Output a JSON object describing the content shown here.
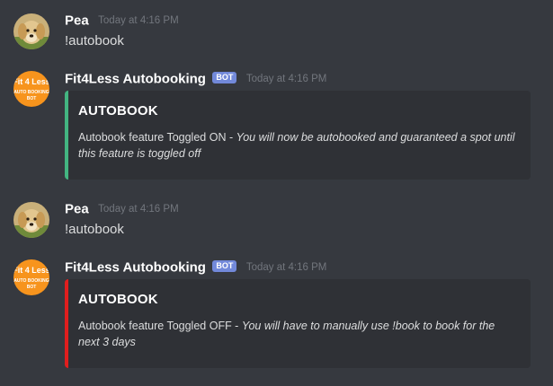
{
  "messages": [
    {
      "author": "Pea",
      "timestamp": "Today at 4:16 PM",
      "content": "!autobook",
      "avatar": "golden-retriever-dog-icon"
    },
    {
      "author": "Fit4Less Autobooking",
      "bot_tag": "BOT",
      "timestamp": "Today at 4:16 PM",
      "avatar": "fit4less-autobooking-logo-icon",
      "avatar_text": [
        "Fit 4 Less",
        "AUTO BOOKING",
        "BOT"
      ],
      "embed": {
        "color": "#43b581",
        "title": "AUTOBOOK",
        "desc_plain": "Autobook feature Toggled ON - ",
        "desc_italic": "You will now be autobooked and guaranteed a spot until this feature is toggled off"
      }
    },
    {
      "author": "Pea",
      "timestamp": "Today at 4:16 PM",
      "content": "!autobook",
      "avatar": "golden-retriever-dog-icon"
    },
    {
      "author": "Fit4Less Autobooking",
      "bot_tag": "BOT",
      "timestamp": "Today at 4:16 PM",
      "avatar": "fit4less-autobooking-logo-icon",
      "avatar_text": [
        "Fit 4 Less",
        "AUTO BOOKING",
        "BOT"
      ],
      "embed": {
        "color": "#e01e1e",
        "title": "AUTOBOOK",
        "desc_plain": "Autobook feature Toggled OFF - ",
        "desc_italic": "You will have to manually use !book to book for the next 3 days"
      }
    }
  ],
  "colors": {
    "background": "#36393f",
    "embed_background": "#2f3136",
    "bot_tag": "#7289da",
    "logo_orange": "#f7941d",
    "on_bar": "#43b581",
    "off_bar": "#e01e1e"
  }
}
